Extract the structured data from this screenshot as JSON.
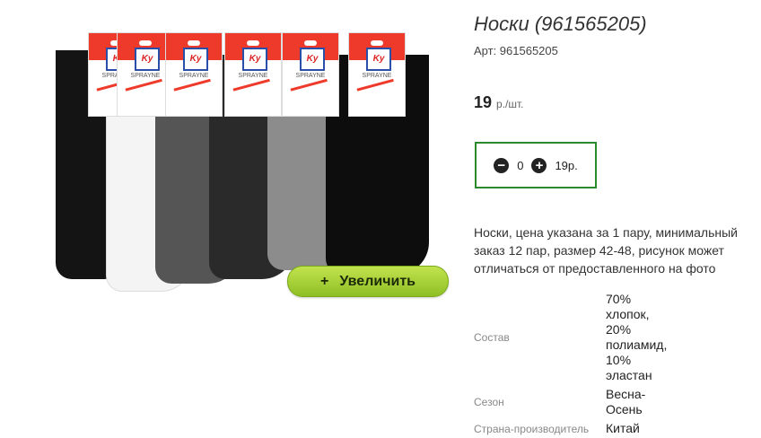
{
  "product": {
    "title": "Носки (961565205)",
    "article": "Арт: 961565205",
    "price": "19",
    "price_unit": "р./шт."
  },
  "image": {
    "zoom_label": "Увеличить",
    "zoom_icon": "plus-icon",
    "card_logo": "Ky",
    "card_brand": "SPRAYNE",
    "sock_colors": [
      "#141414",
      "#f4f4f4",
      "#555555",
      "#2a2a2a",
      "#8c8c8c",
      "#0d0d0d"
    ]
  },
  "quantity": {
    "minus_icon": "minus-circle-icon",
    "plus_icon": "plus-circle-icon",
    "value": "0",
    "total": "19р."
  },
  "description": "Носки, цена указана за 1 пару, минимальный заказ 12 пар, размер 42-48, рисунок может отличаться от предоставленного на фото",
  "properties": [
    {
      "key": "Состав",
      "value": "70% хлопок, 20% полиамид, 10% эластан"
    },
    {
      "key": "Сезон",
      "value": "Весна-Осень"
    },
    {
      "key": "Страна-производитель",
      "value": "Китай"
    }
  ],
  "colors": {
    "accent_green": "#2c8a2c",
    "button_green": "#a6d23a",
    "card_red": "#ee3a2a"
  }
}
